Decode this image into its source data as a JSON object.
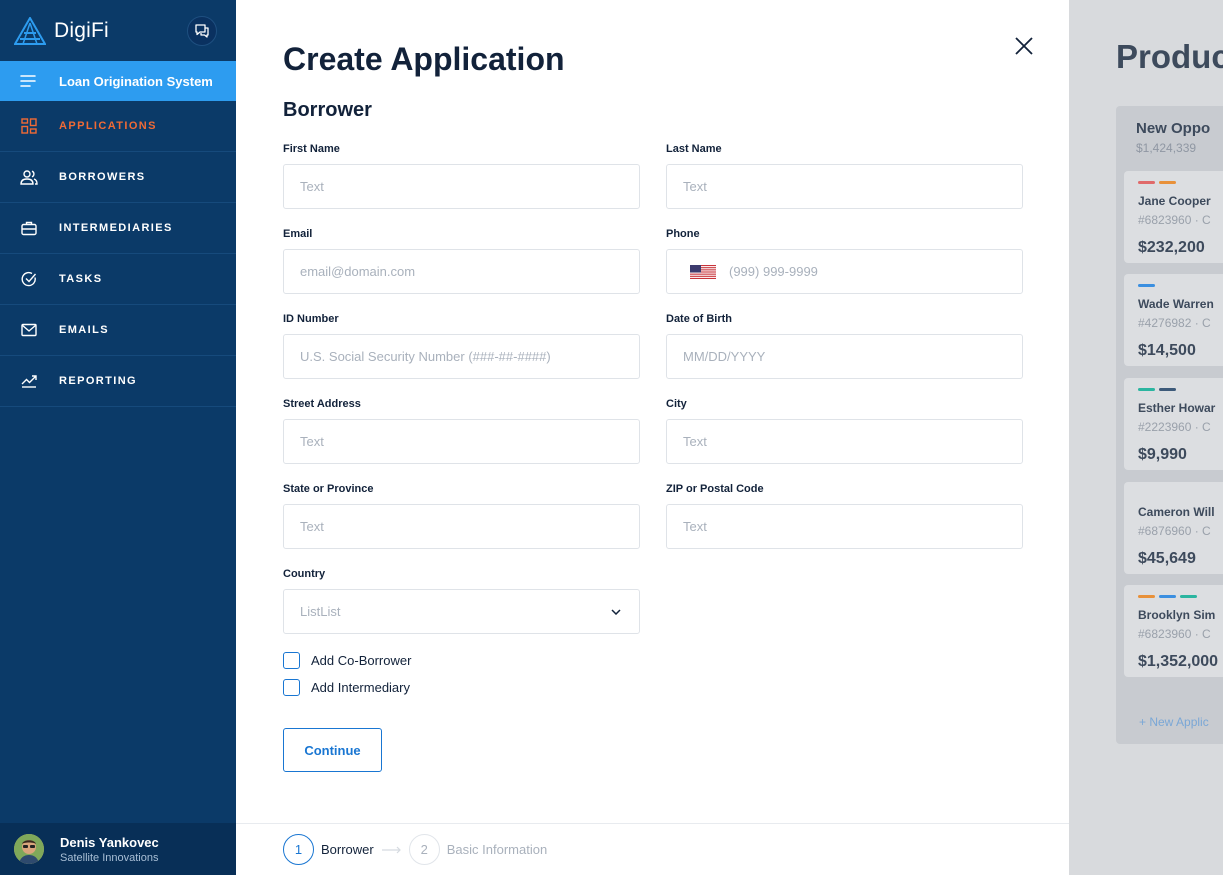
{
  "brand": {
    "name": "DigiFi"
  },
  "sidebar": {
    "system_label": "Loan Origination System",
    "items": [
      {
        "label": "APPLICATIONS",
        "icon": "grid-icon",
        "active": true
      },
      {
        "label": "BORROWERS",
        "icon": "people-icon",
        "active": false
      },
      {
        "label": "INTERMEDIARIES",
        "icon": "briefcase-icon",
        "active": false
      },
      {
        "label": "TASKS",
        "icon": "check-circle-icon",
        "active": false
      },
      {
        "label": "EMAILS",
        "icon": "mail-icon",
        "active": false
      },
      {
        "label": "REPORTING",
        "icon": "chart-line-icon",
        "active": false
      }
    ],
    "active_color": "#f06a35"
  },
  "user": {
    "name": "Denis Yankovec",
    "org": "Satellite Innovations"
  },
  "modal": {
    "title": "Create Application",
    "section": "Borrower",
    "fields": {
      "first_name": {
        "label": "First Name",
        "placeholder": "Text"
      },
      "last_name": {
        "label": "Last Name",
        "placeholder": "Text"
      },
      "email": {
        "label": "Email",
        "placeholder": "email@domain.com"
      },
      "phone": {
        "label": "Phone",
        "placeholder": "(999) 999-9999"
      },
      "id_number": {
        "label": "ID Number",
        "placeholder": "U.S. Social Security Number (###-##-####)"
      },
      "dob": {
        "label": "Date of Birth",
        "placeholder": "MM/DD/YYYY"
      },
      "street": {
        "label": "Street Address",
        "placeholder": "Text"
      },
      "city": {
        "label": "City",
        "placeholder": "Text"
      },
      "state": {
        "label": "State or Province",
        "placeholder": "Text"
      },
      "zip": {
        "label": "ZIP or Postal Code",
        "placeholder": "Text"
      },
      "country": {
        "label": "Country",
        "value": "ListList"
      }
    },
    "checkboxes": {
      "co_borrower": "Add Co-Borrower",
      "intermediary": "Add Intermediary"
    },
    "continue_label": "Continue",
    "steps": [
      {
        "number": "1",
        "label": "Borrower"
      },
      {
        "number": "2",
        "label": "Basic Information"
      }
    ],
    "accent": "#1976d2"
  },
  "board": {
    "title": "Produc",
    "column_title": "New Oppo",
    "column_total": "$1,424,339",
    "cards": [
      {
        "name": "Jane Cooper",
        "id": "#6823960 · C",
        "amount": "$232,200",
        "tags": [
          "#e06a6a",
          "#e8913a"
        ]
      },
      {
        "name": "Wade Warren",
        "id": "#4276982 · C",
        "amount": "$14,500",
        "tags": [
          "#3b8fe0"
        ]
      },
      {
        "name": "Esther Howar",
        "id": "#2223960 · C",
        "amount": "$9,990",
        "tags": [
          "#2bb5a0",
          "#3d5a7a"
        ]
      },
      {
        "name": "Cameron Will",
        "id": "#6876960 · C",
        "amount": "$45,649",
        "tags": []
      },
      {
        "name": "Brooklyn Sim",
        "id": "#6823960 · C",
        "amount": "$1,352,000",
        "tags": [
          "#e8913a",
          "#3b8fe0",
          "#2bb5a0"
        ]
      }
    ],
    "new_label": "+ New Applic"
  }
}
